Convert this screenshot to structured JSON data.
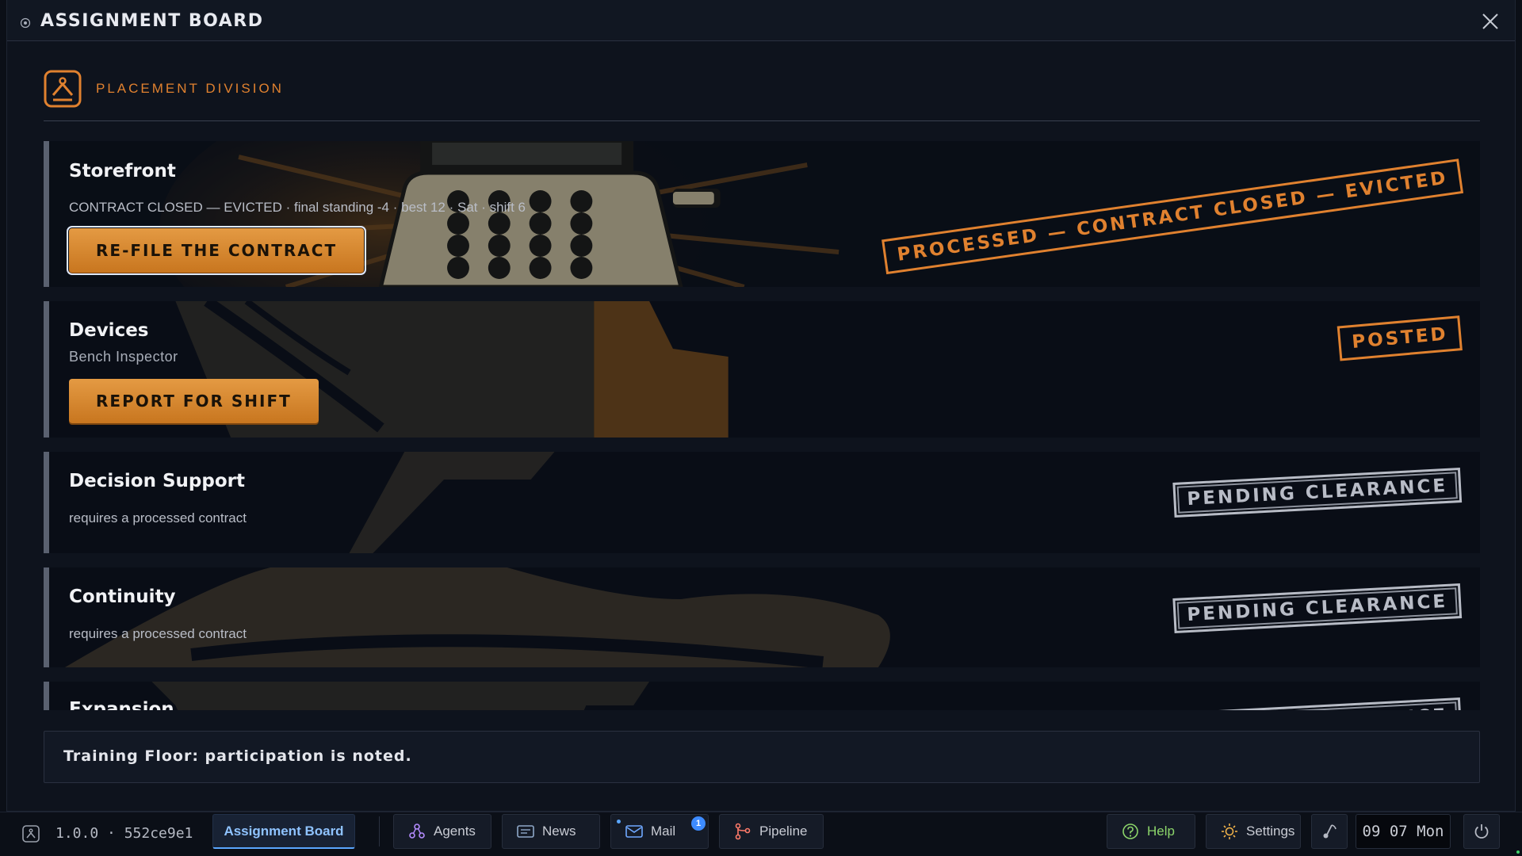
{
  "window": {
    "title": "ASSIGNMENT BOARD"
  },
  "division": {
    "label": "PLACEMENT DIVISION"
  },
  "assignments": [
    {
      "title": "Storefront",
      "subtitle": "CONTRACT CLOSED — EVICTED · final standing -4 · best 12 · Sat · shift 6",
      "action": "RE-FILE THE CONTRACT",
      "stamp": "PROCESSED — CONTRACT CLOSED — EVICTED"
    },
    {
      "title": "Devices",
      "role": "Bench Inspector",
      "action": "REPORT FOR SHIFT",
      "stamp": "POSTED"
    },
    {
      "title": "Decision Support",
      "subtitle": "requires a processed contract",
      "stamp": "PENDING CLEARANCE"
    },
    {
      "title": "Continuity",
      "subtitle": "requires a processed contract",
      "stamp": "PENDING CLEARANCE"
    },
    {
      "title": "Expansion",
      "stamp": "PENDING CLEARANCE"
    }
  ],
  "notice": {
    "text": "Training Floor: participation is noted."
  },
  "taskbar": {
    "version": "1.0.0 · 552ce9e1",
    "active_tab": "Assignment Board",
    "buttons": {
      "agents": "Agents",
      "news": "News",
      "mail": "Mail",
      "mail_badge": "1",
      "pipeline": "Pipeline",
      "help": "Help",
      "settings": "Settings"
    },
    "clock": "09 07 Mon"
  },
  "colors": {
    "accent": "#e0812f",
    "active_tab": "#8fc3ff",
    "help": "#8bd46a",
    "badge": "#3d8bff"
  }
}
